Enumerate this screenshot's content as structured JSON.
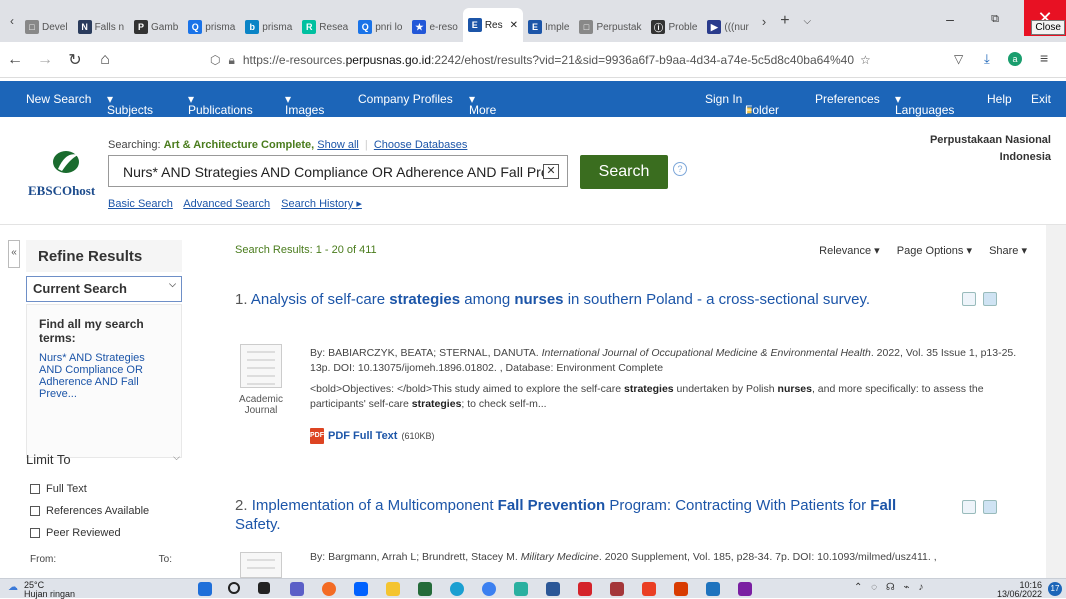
{
  "browser": {
    "tabs": [
      {
        "label": "Devel",
        "icon": "page-icon",
        "color": "#888"
      },
      {
        "label": "Falls n",
        "icon": "n-logo-icon",
        "color": "#2a3b5c"
      },
      {
        "label": "Gamb",
        "icon": "pkp-icon",
        "color": "#333"
      },
      {
        "label": "prisma",
        "icon": "search-icon",
        "color": "#1a73e8"
      },
      {
        "label": "prisma",
        "icon": "bing-icon",
        "color": "#0a84c6"
      },
      {
        "label": "Resea",
        "icon": "rg-icon",
        "color": "#00c0a0"
      },
      {
        "label": "pnri lo",
        "icon": "search-icon",
        "color": "#1a73e8"
      },
      {
        "label": "e-reso",
        "icon": "star-icon",
        "color": "#2257d8"
      },
      {
        "label": "Res",
        "icon": "ebsco-icon",
        "color": "#1c55a8"
      },
      {
        "label": "Imple",
        "icon": "ebsco-icon",
        "color": "#1c55a8"
      },
      {
        "label": "Perpustak",
        "icon": "page-icon",
        "color": "#888"
      },
      {
        "label": "Proble",
        "icon": "info-icon",
        "color": "#333"
      },
      {
        "label": "(((nur",
        "icon": "arrow-icon",
        "color": "#2a3b8c"
      }
    ],
    "close_tooltip": "Close",
    "url_prefix": "https://e-resources.",
    "url_host": "perpusnas.go.id",
    "url_rest": ":2242/ehost/results?vid=21&sid=9936a6f7-b9aa-4d34-a74e-5c5d8c40ba64%40"
  },
  "ebsco_nav": {
    "left": [
      "New Search",
      "Subjects",
      "Publications",
      "Images",
      "Company Profiles",
      "More"
    ],
    "right": [
      "Sign In",
      "Folder",
      "Preferences",
      "Languages",
      "Help",
      "Exit"
    ]
  },
  "header": {
    "logo_text": "EBSCOhost",
    "searching_label": "Searching: ",
    "database": "Art & Architecture Complete,",
    "show_all": "Show all",
    "choose_db": "Choose Databases",
    "query": "Nurs* AND Strategies  AND Compliance OR Adherence AND  Fall Prev",
    "search_button": "Search",
    "links": [
      "Basic Search",
      "Advanced Search",
      "Search History ▸"
    ],
    "institution_line1": "Perpustakaan Nasional",
    "institution_line2": "Indonesia"
  },
  "sidebar": {
    "refine": "Refine Results",
    "current": "Current Search",
    "find_all": "Find all my search terms:",
    "terms": "Nurs* AND Strategies AND Compliance OR Adherence AND Fall Preve...",
    "limit_to": "Limit To",
    "checkboxes": [
      "Full Text",
      "References Available",
      "Peer Reviewed"
    ],
    "from": "From:",
    "to": "To:"
  },
  "results": {
    "count": "Search Results: 1 - 20 of 411",
    "options": [
      "Relevance ▾",
      "Page Options ▾",
      "Share ▾"
    ],
    "items": [
      {
        "num": "1.",
        "title_parts": [
          "Analysis of self-care ",
          "strategies",
          " among ",
          "nurses",
          " in southern Poland - a cross-sectional survey."
        ],
        "type": "Academic Journal",
        "meta_by": "By: BABIARCZYK, BEATA; STERNAL, DANUTA. ",
        "meta_journal": "International Journal of Occupational Medicine & Environmental Health",
        "meta_rest": ". 2022, Vol. 35 Issue 1, p13-25. 13p. DOI: 10.13075/ijomeh.1896.01802. , Database: Environment Complete",
        "abstract_parts": [
          "<bold>Objectives: </bold>This study aimed to explore the self-care ",
          "strategies",
          " undertaken by Polish ",
          "nurses",
          ", and more specifically: to assess the participants' self-care ",
          "strategies",
          "; to check self-m..."
        ],
        "pdf": "PDF Full Text",
        "pdf_size": "(610KB)"
      },
      {
        "num": "2.",
        "title_parts": [
          "Implementation of a Multicomponent ",
          "Fall Prevention",
          " Program: Contracting With Patients for ",
          "Fall",
          " Safety."
        ],
        "meta_by": "By: Bargmann, Arrah L; Brundrett, Stacey M. ",
        "meta_journal": "Military Medicine",
        "meta_rest": ". 2020 Supplement, Vol. 185, p28-34. 7p. DOI: 10.1093/milmed/usz411. ,"
      }
    ]
  },
  "taskbar": {
    "temp": "25°C",
    "weather": "Hujan ringan",
    "time": "10:16",
    "date": "13/06/2022",
    "notifications": "17"
  }
}
